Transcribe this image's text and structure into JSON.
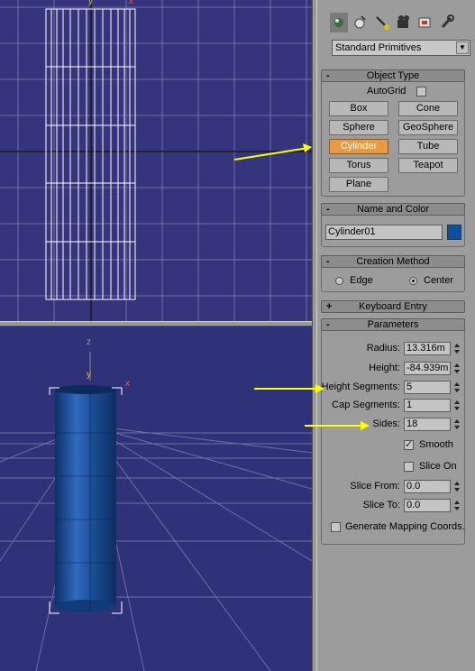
{
  "viewport_top": {
    "axis_y": "y",
    "axis_x": "x"
  },
  "viewport_persp": {
    "axis_z": "z",
    "axis_y": "y",
    "axis_x": "x"
  },
  "panel": {
    "dropdown": "Standard Primitives",
    "tabs": [
      "create-tab-icon",
      "modify-tab-icon",
      "hierarchy-tab-icon",
      "motion-tab-icon",
      "display-tab-icon",
      "utilities-tab-icon"
    ],
    "object_type": {
      "title": "Object Type",
      "sign": "-",
      "autogrid": "AutoGrid",
      "buttons": [
        "Box",
        "Cone",
        "Sphere",
        "GeoSphere",
        "Cylinder",
        "Tube",
        "Torus",
        "Teapot",
        "Plane"
      ],
      "active": "Cylinder"
    },
    "name_color": {
      "title": "Name and Color",
      "sign": "-",
      "name": "Cylinder01",
      "color": "#0a4fa0"
    },
    "creation_method": {
      "title": "Creation Method",
      "sign": "-",
      "edge": "Edge",
      "center": "Center",
      "selected": "Center"
    },
    "keyboard_entry": {
      "title": "Keyboard Entry",
      "sign": "+"
    },
    "parameters": {
      "title": "Parameters",
      "sign": "-",
      "radius_label": "Radius:",
      "radius": "13.316m",
      "height_label": "Height:",
      "height": "-84.939m",
      "height_segments_label": "Height Segments:",
      "height_segments": "5",
      "cap_segments_label": "Cap Segments:",
      "cap_segments": "1",
      "sides_label": "Sides:",
      "sides": "18",
      "smooth_label": "Smooth",
      "smooth": true,
      "slice_on_label": "Slice On",
      "slice_on": false,
      "slice_from_label": "Slice From:",
      "slice_from": "0.0",
      "slice_to_label": "Slice To:",
      "slice_to": "0.0",
      "gen_mapping_label": "Generate Mapping Coords.",
      "gen_mapping": false
    }
  },
  "colors": {
    "viewport_bg": "#35357d",
    "grid": "#7f7fb0",
    "active_button": "#e99b43",
    "arrow": "#ffff00",
    "cylinder": "#1d4f97"
  }
}
